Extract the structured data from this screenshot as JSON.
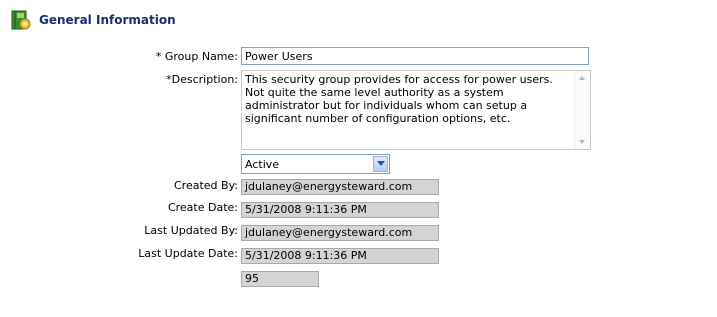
{
  "header": {
    "title": "General Information",
    "icon": "gear-book-icon"
  },
  "form": {
    "group_name_label": "* Group Name:",
    "group_name_value": "Power Users",
    "description_label": "*Description:",
    "description_value": "This security group provides for access for power users.  Not quite the same level authority as a system administrator but for individuals whom can setup a significant number of configuration options, etc.",
    "status_value": "Active",
    "created_by_label": "Created By:",
    "created_by_value": "jdulaney@energysteward.com",
    "create_date_label": "Create Date:",
    "create_date_value": "5/31/2008 9:11:36 PM",
    "last_updated_by_label": "Last Updated By:",
    "last_updated_by_value": "jdulaney@energysteward.com",
    "last_update_date_label": "Last Update Date:",
    "last_update_date_value": "5/31/2008 9:11:36 PM",
    "id_value": "95"
  },
  "colors": {
    "title": "#1a2e6e",
    "readonly_bg": "#d4d4d4",
    "input_border": "#7fa4c9"
  }
}
